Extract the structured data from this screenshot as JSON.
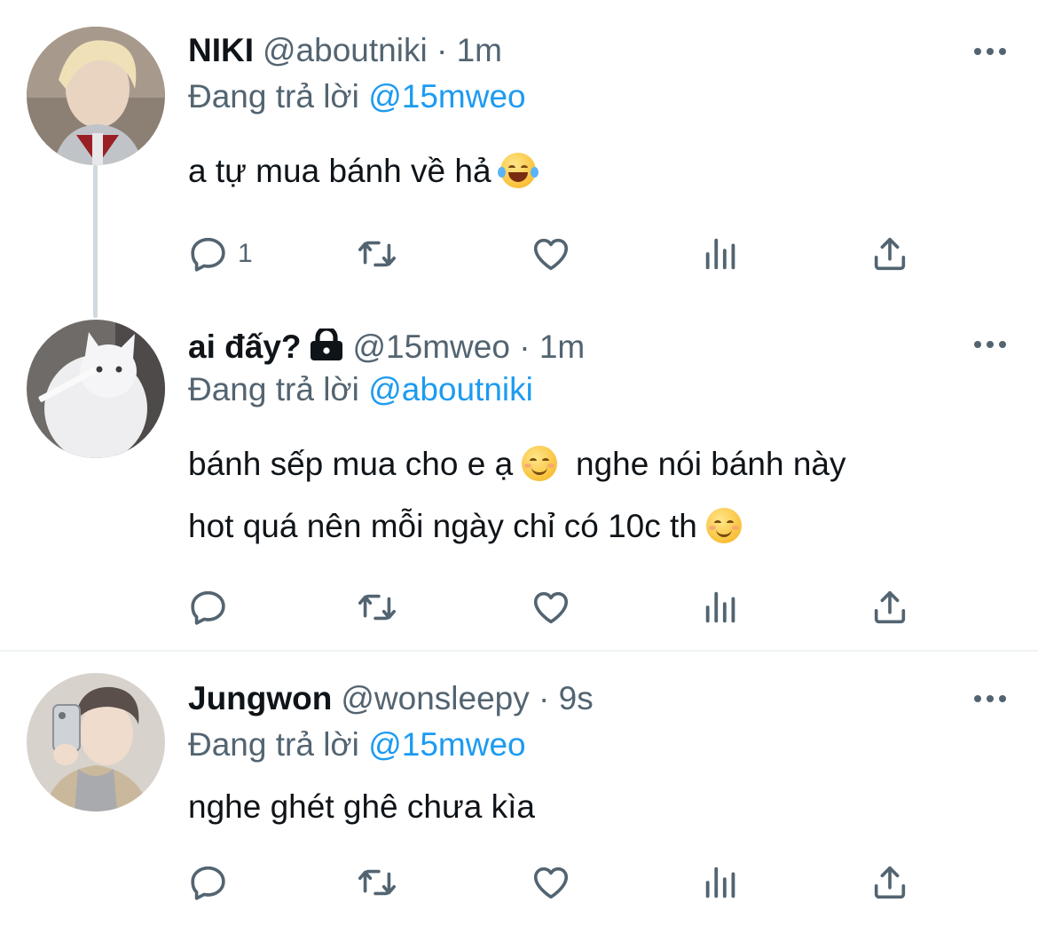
{
  "tweets": [
    {
      "name": "NIKI",
      "handle": "@aboutniki",
      "time": "1m",
      "replying_label": "Đang trả lời",
      "replying_to": "@15mweo",
      "text_parts": [
        "a tự mua bánh về hả"
      ],
      "reply_count": "1",
      "icons": {
        "more": "more-dots-icon",
        "reply": "reply-bubble-icon",
        "retweet": "retweet-icon",
        "like": "heart-icon",
        "stats": "bar-chart-icon",
        "share": "share-upload-icon"
      }
    },
    {
      "name": "ai đấy?",
      "handle": "@15mweo",
      "time": "1m",
      "replying_label": "Đang trả lời",
      "replying_to": "@aboutniki",
      "text_line1": "bánh sếp mua cho e ạ",
      "text_line1b": "nghe nói bánh này",
      "text_line2": "hot quá nên mỗi ngày chỉ có 10c th",
      "reply_count": "",
      "protected": true
    },
    {
      "name": "Jungwon",
      "handle": "@wonsleepy",
      "time": "9s",
      "replying_label": "Đang trả lời",
      "replying_to": "@15mweo",
      "text": "nghe ghét ghê chưa kìa",
      "reply_count": ""
    }
  ],
  "separator": "·",
  "colors": {
    "text": "#0f1419",
    "muted": "#536471",
    "link": "#1d9bf0",
    "border": "#eff3f4",
    "thread": "#cfd9de"
  }
}
